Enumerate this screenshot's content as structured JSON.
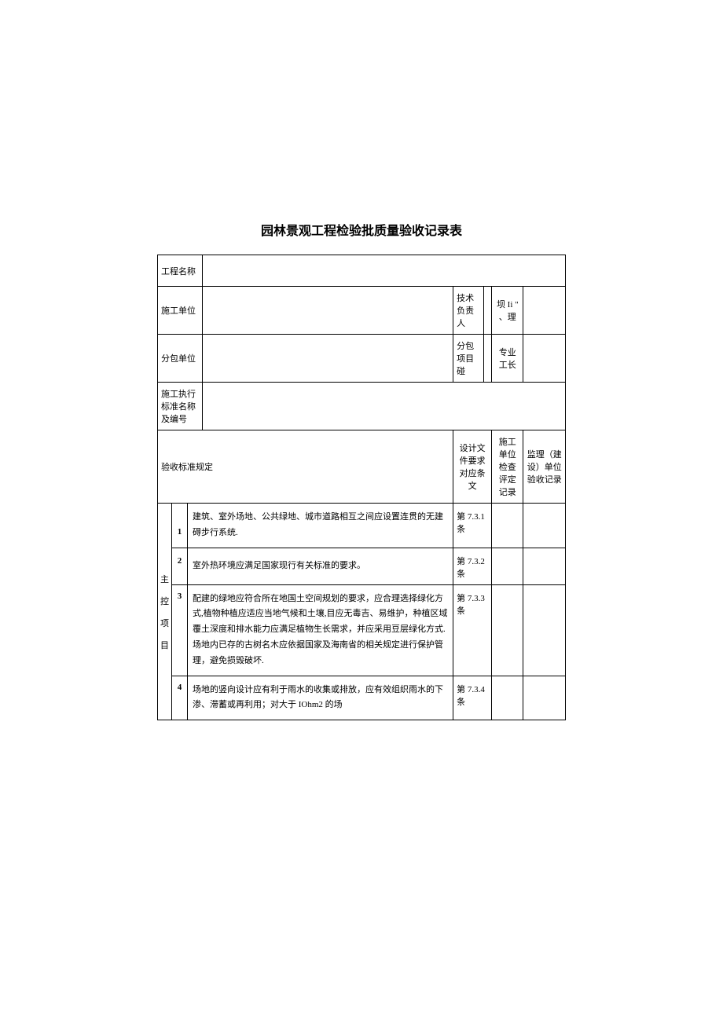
{
  "title": "园林景观工程检验批质量验收记录表",
  "labels": {
    "project_name": "工程名称",
    "construction_unit": "施工单位",
    "tech_lead": "技术负责人",
    "supervisor_li": "坝 Ii \" 、理",
    "subcontractor": "分包单位",
    "sub_project": "分包项目碰",
    "specialty_foreman": "专业工长",
    "standard_name_code": "施工执行标准名称及编号",
    "acceptance_standard": "验收标准规定",
    "design_clause": "设计文件要求对应条文",
    "inspection_record": "施工单位检查评定记录",
    "supervision_record": "监理（建设）单位验收记录",
    "main_control_item": "主控项目"
  },
  "rows": [
    {
      "num": "1",
      "desc": "建筑、室外场地、公共绿地、城市道路相互之间应设置连贯的无建碍步行系统.",
      "clause": "第 7.3.1 条"
    },
    {
      "num": "2",
      "desc": "室外热环境应满足国家现行有关标准的要求。",
      "clause": "第 7.3.2 条"
    },
    {
      "num": "3",
      "desc": "配建的绿地应符合所在地国土空间规划的要求，应合理选择绿化方式,植物种植应适应当地气候和土壤,目应无毒吉、易维护，种植区域覆土深度和排水能力应满足植物生长需求，并应采用豆层绿化方式.场地内已存的古树名木应依据国家及海南省的相关规定进行保护管理，避免损毁破坏.",
      "clause": "第 7.3.3 条"
    },
    {
      "num": "4",
      "desc": "场地的竖向设计应有利于雨水的收集或排放，应有效组织雨水的下渗、滞蓄或再利用；对大于 IOhm2 的场",
      "clause": "第 7.3.4 条"
    }
  ]
}
